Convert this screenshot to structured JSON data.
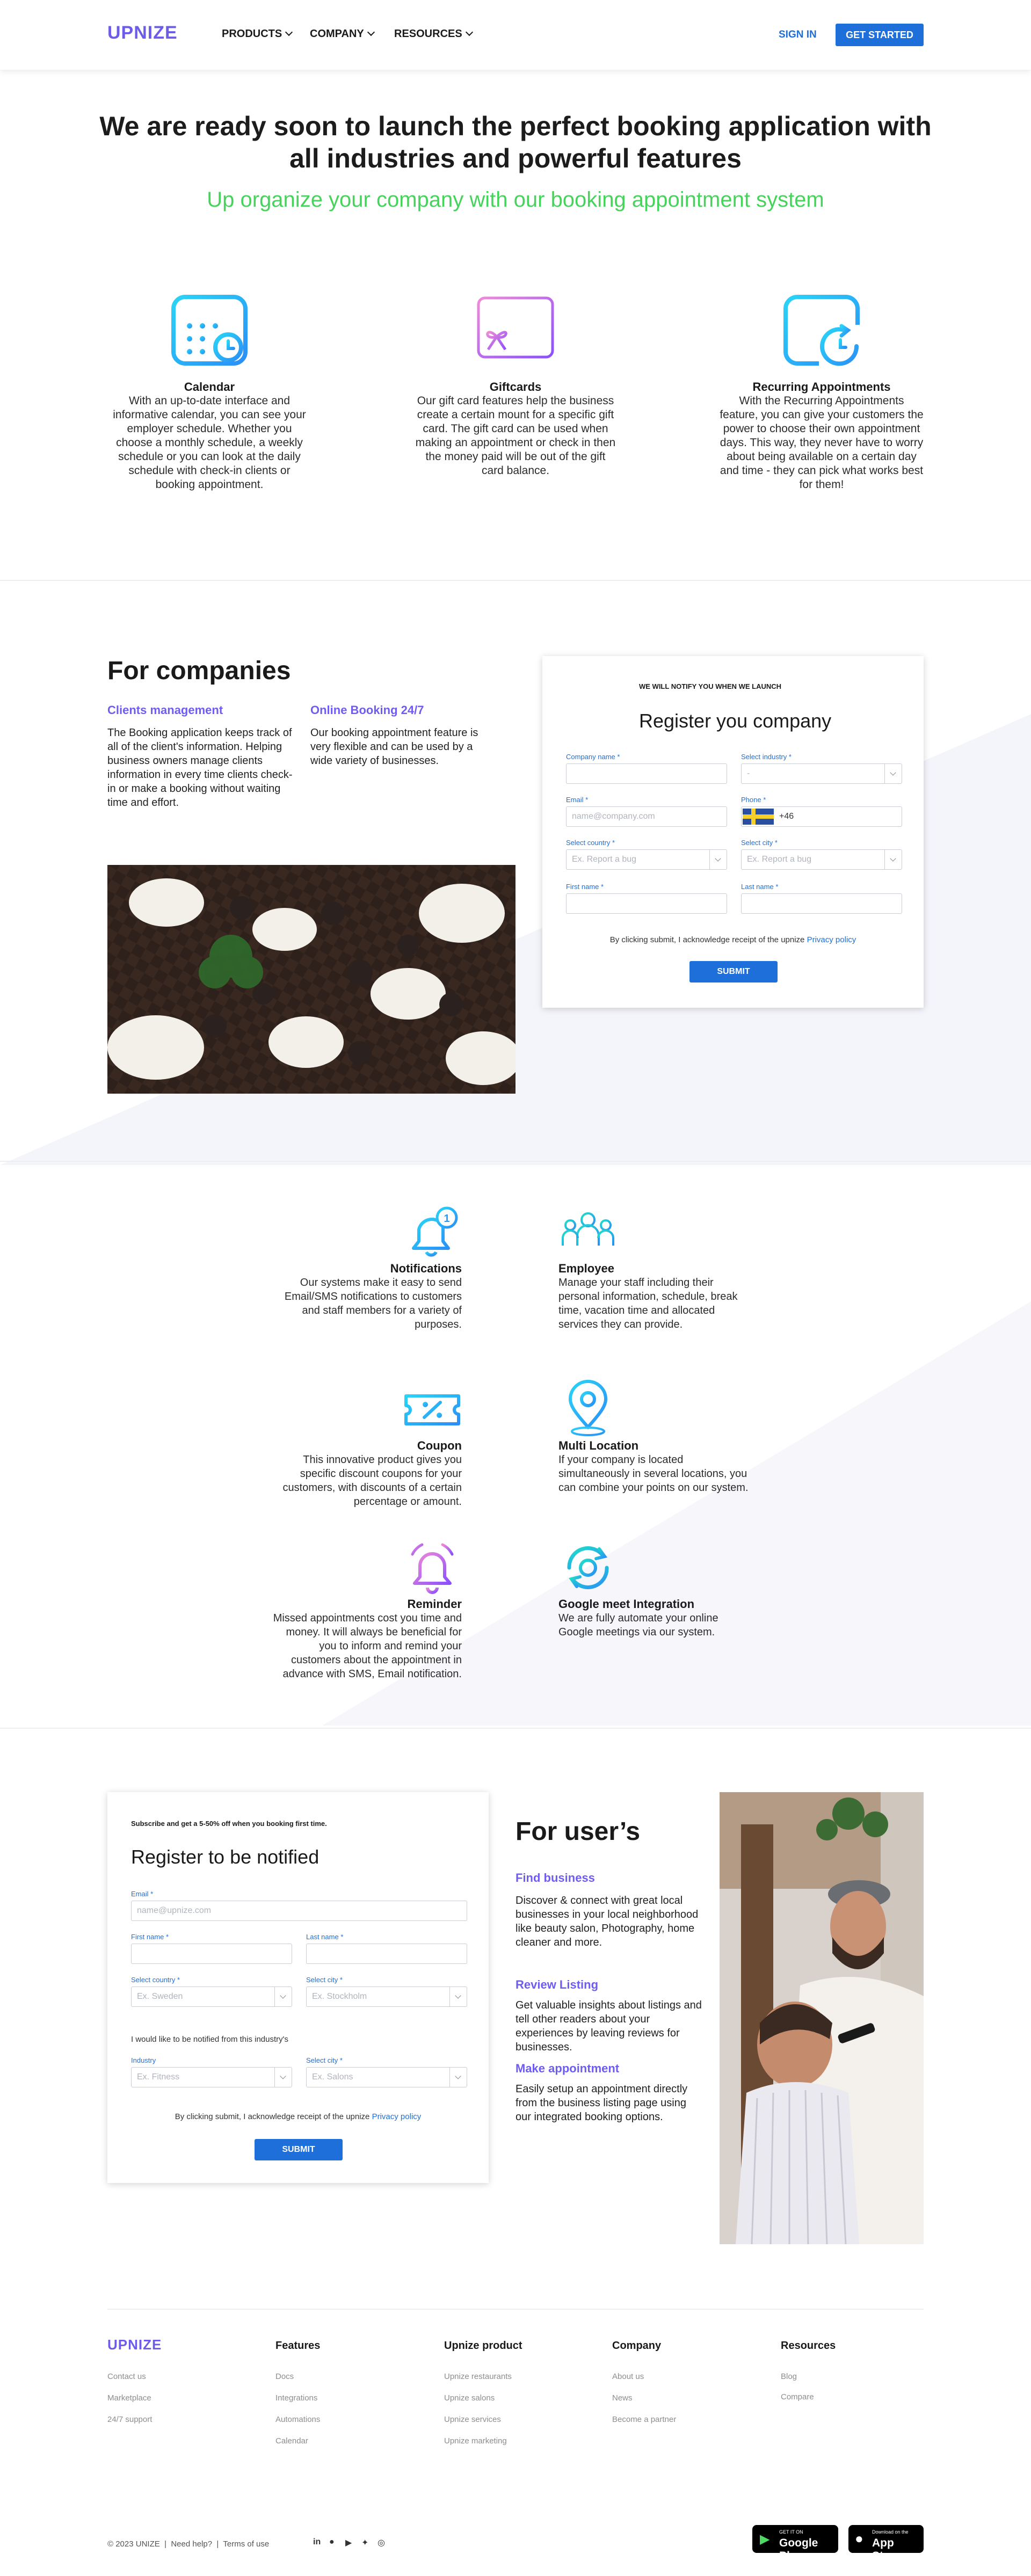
{
  "header": {
    "logo": "UPNIZE",
    "nav": [
      {
        "label": "PRODUCTS"
      },
      {
        "label": "COMPANY"
      },
      {
        "label": "RESOURCES"
      }
    ],
    "signin": "SIGN IN",
    "get_started": "GET STARTED"
  },
  "hero": {
    "title": "We are ready soon to launch the perfect booking application with all industries and powerful features",
    "subtitle": "Up organize your company with our booking appointment system"
  },
  "features": [
    {
      "title": "Calendar",
      "text": "With an up-to-date interface and informative calendar, you can see your employer schedule. Whether you choose a monthly schedule, a weekly schedule or you can look at the daily schedule with check-in clients or booking appointment.",
      "icon": "calendar-icon"
    },
    {
      "title": "Giftcards",
      "text": "Our gift card features help the business create a certain mount for a specific gift card. The gift card can be used when making an appointment or check in then the money paid will be out of the gift card balance.",
      "icon": "giftcard-icon"
    },
    {
      "title": "Recurring Appointments",
      "text": "With the Recurring Appointments feature, you can give your customers the power to choose their own appointment days. This way, they never have to worry about being available on a certain day and time - they can pick what works best for them!",
      "icon": "recurring-calendar-icon"
    }
  ],
  "companies": {
    "title": "For companies",
    "col1_title": "Clients management",
    "col1_text": "The Booking application keeps track of all of the client's information. Helping business owners manage clients information in every time clients check-in or make a booking without waiting time and effort.",
    "col2_title": "Online Booking 24/7",
    "col2_text": "Our booking appointment feature is very flexible and can be used by a wide variety of businesses.",
    "form": {
      "kicker": "WE WILL NOTIFY YOU WHEN WE LAUNCH",
      "title": "Register you company",
      "company_name_label": "Company name *",
      "industry_label": "Select industry *",
      "industry_value": "-",
      "email_label": "Email *",
      "email_placeholder": "name@company.com",
      "phone_label": "Phone *",
      "phone_value": "+46",
      "country_label": "Select country *",
      "country_placeholder": "Ex. Report a bug",
      "city_label": "Select city *",
      "city_placeholder": "Ex. Report a bug",
      "first_name_label": "First name *",
      "last_name_label": "Last name *",
      "consent": "By clicking submit, I acknowledge receipt of the upnize",
      "policy": "Privacy policy",
      "submit": "SUBMIT"
    }
  },
  "grid": [
    {
      "title": "Notifications",
      "text": "Our systems make it easy to send Email/SMS notifications to customers and staff members for a variety of purposes.",
      "icon": "bell-icon"
    },
    {
      "title": "Employee",
      "text": "Manage your staff including their personal information, schedule, break time, vacation time and allocated services they can provide.",
      "icon": "team-icon"
    },
    {
      "title": "Coupon",
      "text": "This innovative product gives you specific discount coupons for your customers, with discounts of a certain percentage or amount.",
      "icon": "coupon-icon"
    },
    {
      "title": "Multi Location",
      "text": "If your company is located simultaneously in several locations, you can combine your points on our system.",
      "icon": "location-pin-icon"
    },
    {
      "title": "Reminder",
      "text": "Missed appointments cost you time and money. It will always be beneficial for you to inform and remind your customers about the appointment in advance with SMS, Email notification.",
      "icon": "reminder-bell-icon"
    },
    {
      "title": "Google meet Integration",
      "text": "We are fully automate your online Google meetings via our system.",
      "icon": "sync-icon"
    }
  ],
  "users": {
    "form": {
      "kicker": "Subscribe and get a 5-50% off when you booking first time.",
      "title": "Register to be notified",
      "email_label": "Email *",
      "email_placeholder": "name@upnize.com",
      "first_name_label": "First name *",
      "last_name_label": "Last name *",
      "country_label": "Select country *",
      "country_placeholder": "Ex. Sweden",
      "city_label": "Select city *",
      "city_placeholder": "Ex. Stockholm",
      "industry_intro": "I would like to be notified from this industry's",
      "industry_label": "Industry",
      "industry_placeholder": "Ex. Fitness",
      "city2_label": "Select city *",
      "city2_placeholder": "Ex. Salons",
      "consent": "By clicking submit, I acknowledge receipt of the upnize",
      "policy": "Privacy policy",
      "submit": "SUBMIT"
    },
    "title": "For user’s",
    "items": [
      {
        "title": "Find business",
        "text": "Discover & connect with great local businesses in your local neighborhood like beauty salon, Photography, home cleaner and more."
      },
      {
        "title": "Review Listing",
        "text": "Get valuable insights about listings and tell other readers about your experiences by leaving reviews for businesses."
      },
      {
        "title": "Make appointment",
        "text": "Easily setup an appointment directly from the business listing page using our integrated booking options."
      }
    ]
  },
  "footer": {
    "logo": "UPNIZE",
    "col1": [
      "Contact us",
      "Marketplace",
      "24/7 support"
    ],
    "features_title": "Features",
    "features": [
      "Docs",
      "Integrations",
      "Automations",
      "Calendar"
    ],
    "product_title": "Upnize product",
    "product": [
      "Upnize restaurants",
      "Upnize salons",
      "Upnize services",
      "Upnize marketing"
    ],
    "company_title": "Company",
    "company": [
      "About us",
      "News",
      "Become a partner"
    ],
    "resources_title": "Resources",
    "resources": [
      "Blog",
      "Compare"
    ],
    "copyright": "© 2023 UNIZE",
    "help": "Need help?",
    "terms": "Terms of use",
    "google_small": "GET IT ON",
    "google_big": "Google Play",
    "apple_small": "Download on the",
    "apple_big": "App Store"
  }
}
